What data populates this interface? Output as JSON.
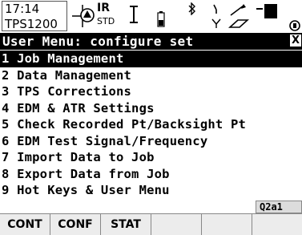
{
  "status": {
    "time": "17:14",
    "instrument": "TPS1200",
    "target_mode": "IR",
    "measure_mode": "STD"
  },
  "title": "User Menu: configure set",
  "close_label": "X",
  "menu": {
    "items": [
      {
        "label": "1 Job Management",
        "selected": true
      },
      {
        "label": "2 Data Management"
      },
      {
        "label": "3 TPS Corrections"
      },
      {
        "label": "4 EDM & ATR Settings"
      },
      {
        "label": "5 Check Recorded Pt/Backsight Pt"
      },
      {
        "label": "6 EDM Test Signal/Frequency"
      },
      {
        "label": "7 Import Data to Job"
      },
      {
        "label": "8 Export Data from Job"
      },
      {
        "label": "9 Hot Keys & User Menu"
      }
    ]
  },
  "input_mode": "Q2a1",
  "softkeys": [
    "CONT",
    "CONF",
    "STAT",
    "",
    "",
    ""
  ],
  "icons": {
    "tilt": "crosshair-plus-icon",
    "target": "prism-target-icon",
    "cursor": "i-beam-icon",
    "battery": "battery-icon",
    "bluetooth": "bluetooth-icon",
    "radio": "radio-icon",
    "link": "link-icon",
    "memory": "memory-card-icon"
  }
}
